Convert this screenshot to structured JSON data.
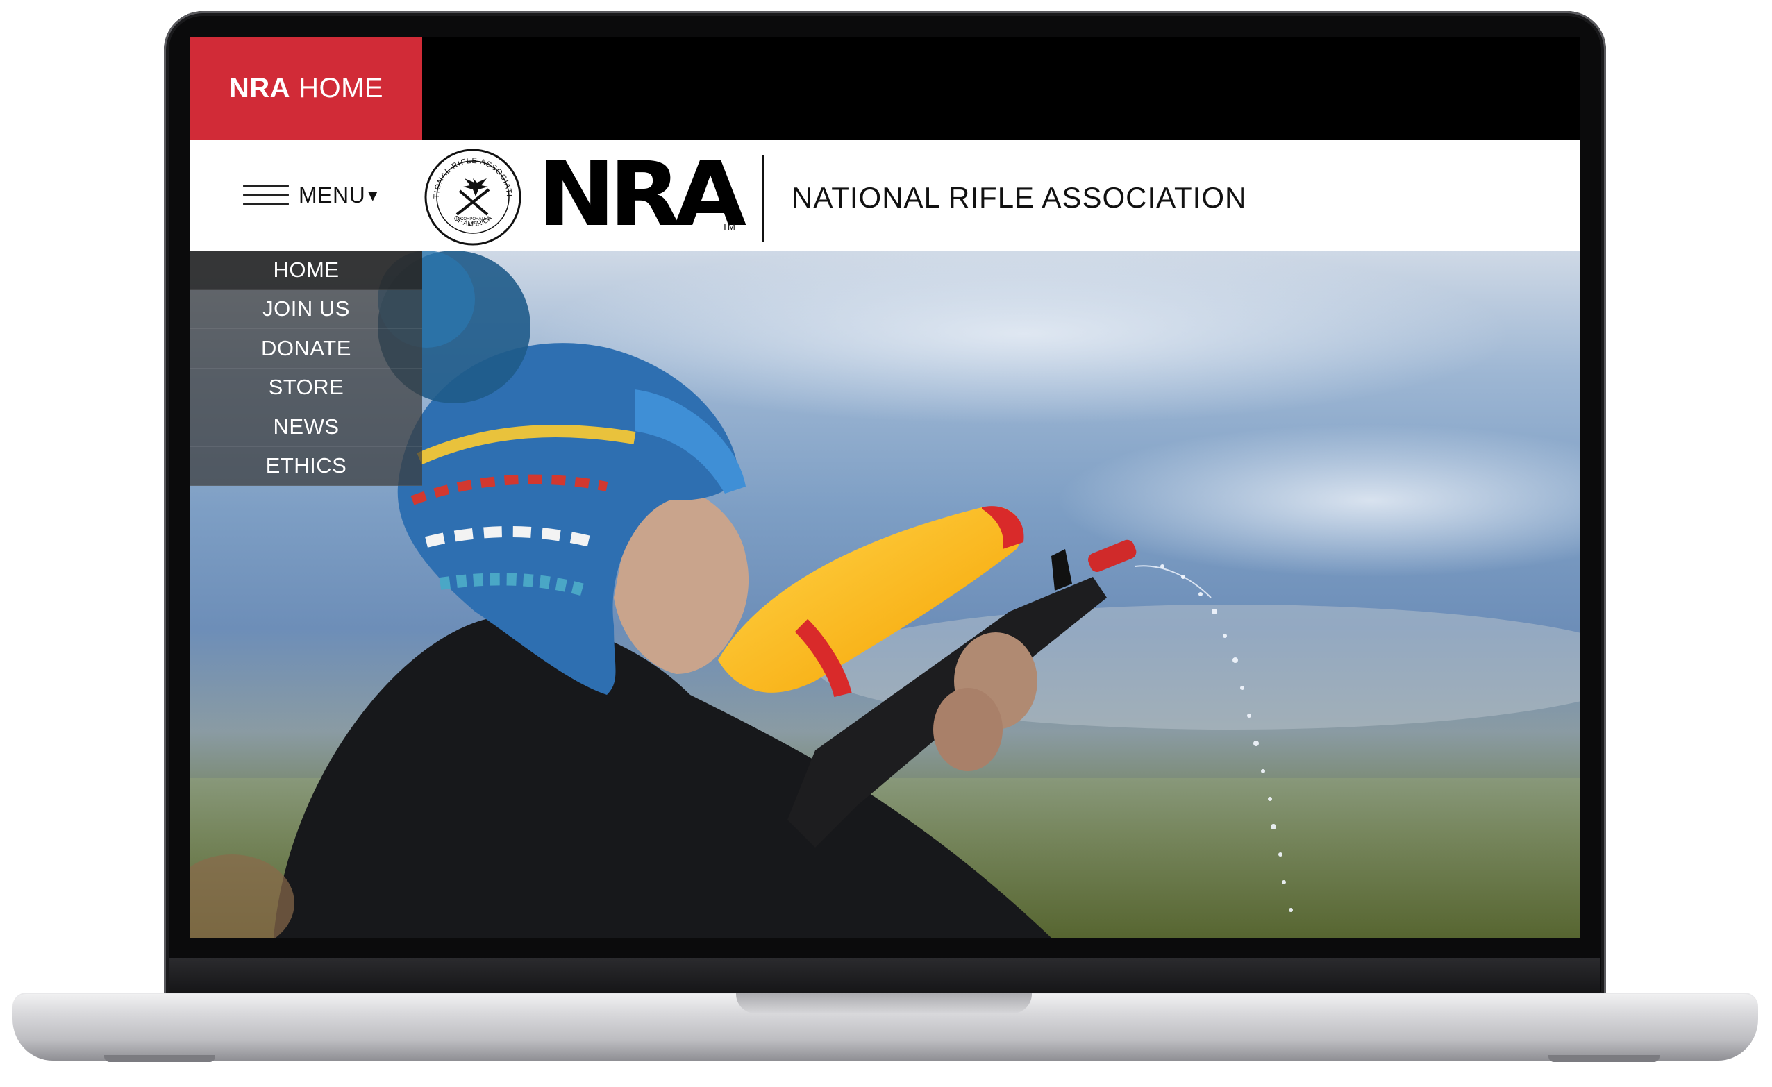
{
  "top_tab": {
    "brand": "NRA",
    "label": "HOME"
  },
  "header": {
    "menu_label": "MENU",
    "menu_caret": "▾",
    "logo_text": "NRA",
    "trademark": "TM",
    "org_name": "NATIONAL RIFLE ASSOCIATION",
    "seal_text_top": "NATIONAL RIFLE ASSOCIATION",
    "seal_text_bottom": "OF AMERICA",
    "seal_text_mid": "INCORPORATED",
    "seal_year": "1871"
  },
  "side_menu": {
    "items": [
      {
        "label": "HOME",
        "active": true
      },
      {
        "label": "JOIN US",
        "active": false
      },
      {
        "label": "DONATE",
        "active": false
      },
      {
        "label": "STORE",
        "active": false
      },
      {
        "label": "NEWS",
        "active": false
      },
      {
        "label": "ETHICS",
        "active": false
      }
    ]
  },
  "colors": {
    "accent": "#d12b37",
    "header_bg": "#ffffff",
    "menu_overlay": "#3c3c3c"
  },
  "hero": {
    "image_subject": "child in knit hat holding toy water gun"
  }
}
